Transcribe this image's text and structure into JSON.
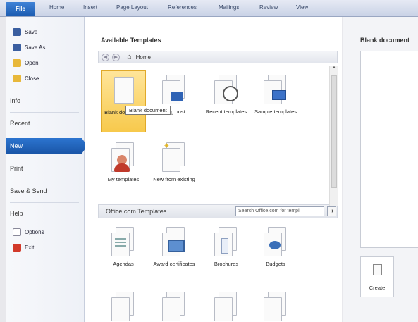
{
  "ribbon": {
    "file": "File",
    "tabs": [
      "Home",
      "Insert",
      "Page Layout",
      "References",
      "Mailings",
      "Review",
      "View"
    ]
  },
  "nav": {
    "commands": [
      {
        "label": "Save",
        "icon": "save-icon"
      },
      {
        "label": "Save As",
        "icon": "save-as-icon"
      },
      {
        "label": "Open",
        "icon": "open-folder-icon"
      },
      {
        "label": "Close",
        "icon": "close-folder-icon"
      }
    ],
    "items": [
      "Info",
      "Recent",
      "New",
      "Print",
      "Save & Send",
      "Help"
    ],
    "active": "New",
    "bottom_commands": [
      {
        "label": "Options",
        "icon": "options-icon"
      },
      {
        "label": "Exit",
        "icon": "exit-icon"
      }
    ]
  },
  "main": {
    "available_title": "Available Templates",
    "breadcrumb": {
      "home_label": "Home"
    },
    "templates": [
      {
        "label": "Blank document",
        "icon": "blank-document-icon",
        "selected": true
      },
      {
        "label": "Blog post",
        "icon": "blog-post-icon"
      },
      {
        "label": "Recent templates",
        "icon": "recent-templates-icon"
      },
      {
        "label": "Sample templates",
        "icon": "sample-templates-icon"
      },
      {
        "label": "My templates",
        "icon": "my-templates-icon"
      },
      {
        "label": "New from existing",
        "icon": "new-from-existing-icon"
      }
    ],
    "tooltip": "Blank document",
    "office_title": "Office.com Templates",
    "search_placeholder": "Search Office.com for templ",
    "office_templates": [
      {
        "label": "Agendas",
        "icon": "agendas-icon"
      },
      {
        "label": "Award certificates",
        "icon": "award-certificates-icon"
      },
      {
        "label": "Brochures",
        "icon": "brochures-icon"
      },
      {
        "label": "Budgets",
        "icon": "budgets-icon"
      }
    ]
  },
  "preview": {
    "title": "Blank document",
    "create_label": "Create"
  },
  "colors": {
    "accent": "#1a56a8",
    "selected_fill": "#f7c94c"
  }
}
